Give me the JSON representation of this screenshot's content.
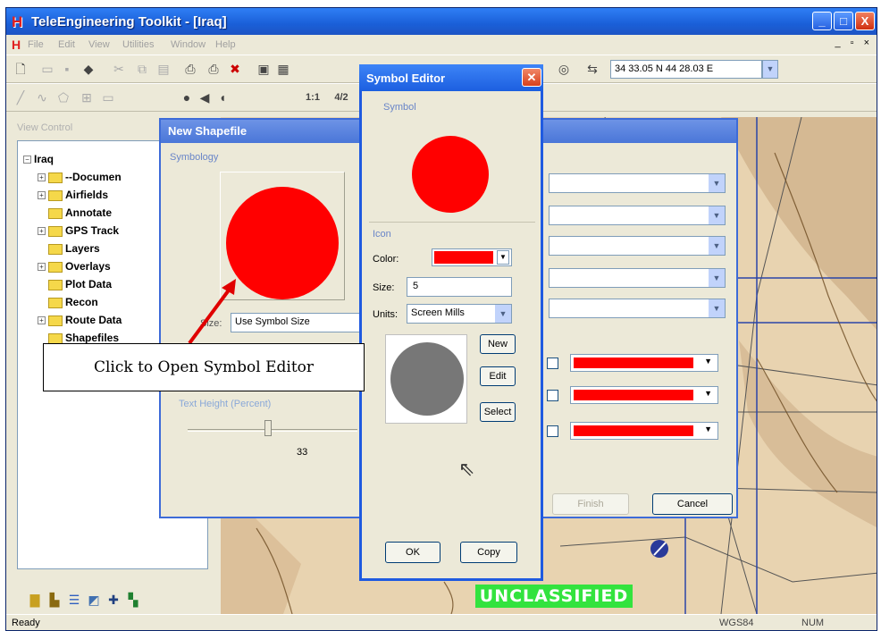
{
  "window": {
    "title": "TeleEngineering Toolkit - [Iraq]",
    "logo_letter": "H",
    "min": "_",
    "max": "□",
    "close": "X"
  },
  "menubar": {
    "logo_letter": "H",
    "items": [
      "File",
      "Edit",
      "View",
      "Utilities",
      "Window",
      "Help"
    ],
    "mdi_controls": "_ ▫ ×"
  },
  "toolbar": {
    "coordinates": "34 33.05 N  44 28.03 E",
    "scale_1": "1:1",
    "scale_2": "4/2"
  },
  "view_control": {
    "label": "View Control",
    "root": "Iraq",
    "items": [
      {
        "label": "--Documen",
        "expandable": true
      },
      {
        "label": "Airfields",
        "expandable": true
      },
      {
        "label": "Annotate",
        "expandable": false
      },
      {
        "label": "GPS Track",
        "expandable": true
      },
      {
        "label": "Layers",
        "expandable": false
      },
      {
        "label": "Overlays",
        "expandable": true
      },
      {
        "label": "Plot Data",
        "expandable": false
      },
      {
        "label": "Recon",
        "expandable": false
      },
      {
        "label": "Route Data",
        "expandable": true
      },
      {
        "label": "Shapefiles",
        "expandable": false
      }
    ]
  },
  "new_shapefile": {
    "title": "New Shapefile",
    "symbology_label": "Symbology",
    "symbol_color": "#ff0000",
    "size_label": "Size:",
    "size_value": "Use Symbol Size",
    "text_height_label": "Text Height (Percent)",
    "text_height_value": "33",
    "text_height_fraction": 0.43,
    "finish_label": "Finish",
    "cancel_label": "Cancel"
  },
  "symbol_editor": {
    "title": "Symbol Editor",
    "symbol_label": "Symbol",
    "symbol_color": "#ff0000",
    "icon_label": "Icon",
    "color_label": "Color:",
    "color_value": "#ff0000",
    "size_label": "Size:",
    "size_value": "5",
    "units_label": "Units:",
    "units_value": "Screen Mills",
    "icon_preview_color": "#777777",
    "new_label": "New",
    "edit_label": "Edit",
    "select_label": "Select",
    "ok_label": "OK",
    "copy_label": "Copy"
  },
  "callout": {
    "text": "Click to Open Symbol Editor"
  },
  "classification": "UNCLASSIFIED",
  "status": {
    "ready": "Ready",
    "datum": "WGS84",
    "num": "NUM"
  }
}
